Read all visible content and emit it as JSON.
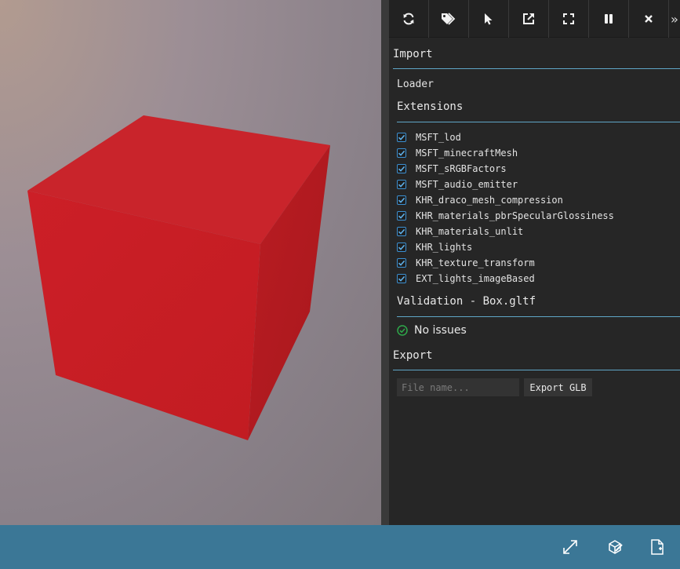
{
  "toolbar": {
    "buttons": [
      "refresh-icon",
      "tags-icon",
      "pointer-icon",
      "open-external-icon",
      "expand-icon",
      "pause-icon",
      "close-icon"
    ],
    "overflow": "»"
  },
  "import": {
    "title": "Import",
    "loader_label": "Loader"
  },
  "extensions": {
    "title": "Extensions",
    "items": [
      {
        "label": "MSFT_lod",
        "checked": true
      },
      {
        "label": "MSFT_minecraftMesh",
        "checked": true
      },
      {
        "label": "MSFT_sRGBFactors",
        "checked": true
      },
      {
        "label": "MSFT_audio_emitter",
        "checked": true
      },
      {
        "label": "KHR_draco_mesh_compression",
        "checked": true
      },
      {
        "label": "KHR_materials_pbrSpecularGlossiness",
        "checked": true
      },
      {
        "label": "KHR_materials_unlit",
        "checked": true
      },
      {
        "label": "KHR_lights",
        "checked": true
      },
      {
        "label": "KHR_texture_transform",
        "checked": true
      },
      {
        "label": "EXT_lights_imageBased",
        "checked": true
      }
    ]
  },
  "validation": {
    "title": "Validation - Box.gltf",
    "status": "No issues"
  },
  "export": {
    "title": "Export",
    "filename_placeholder": "File name...",
    "filename_value": "",
    "button_label": "Export GLB"
  },
  "footer": {
    "buttons": [
      "fullscreen-icon",
      "inspector-icon",
      "new-file-icon"
    ]
  },
  "colors": {
    "accent_line": "#5fa6c7",
    "footer_bg": "#3b7796",
    "checkbox": "#3b8fd1",
    "cube_red": "#c8202a",
    "success_green": "#2ea84a"
  }
}
